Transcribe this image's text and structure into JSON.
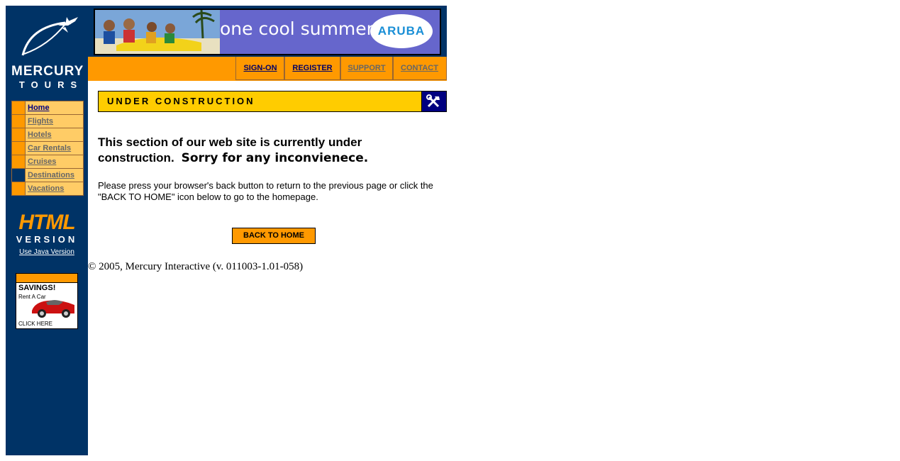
{
  "sidebar": {
    "logo": {
      "word1": "MERCURY",
      "word2": "TOURS"
    },
    "nav": [
      {
        "label": "Home",
        "active": true
      },
      {
        "label": "Flights",
        "active": false
      },
      {
        "label": "Hotels",
        "active": false
      },
      {
        "label": "Car Rentals",
        "active": false
      },
      {
        "label": "Cruises",
        "active": false
      },
      {
        "label": "Destinations",
        "active": false
      },
      {
        "label": "Vacations",
        "active": false
      }
    ],
    "html_version": {
      "big": "HTML",
      "small": "VERSION",
      "java_link": "Use Java Version"
    },
    "ad": {
      "title": "SAVINGS!",
      "subtitle": "Rent A Car",
      "cta": "CLICK HERE"
    }
  },
  "banner": {
    "text": "one cool summer",
    "brand": "ARUBA"
  },
  "topnav": {
    "signon": "SIGN-ON",
    "register": "REGISTER",
    "support": "SUPPORT",
    "contact": "CONTACT"
  },
  "main": {
    "section_title": "UNDER CONSTRUCTION",
    "heading": "This section of our web site is currently under construction.",
    "apology": "Sorry for any inconvienece.",
    "body": "Please press your browser's back button to return to the previous page or click the \"BACK TO HOME\" icon below to go to the homepage.",
    "back_button": "BACK TO HOME"
  },
  "footer": {
    "copyright": "© 2005, Mercury Interactive (v. 011003-1.01-058)"
  },
  "colors": {
    "navy": "#003366",
    "orange": "#ff9900",
    "yellow": "#ffcc00",
    "light_orange": "#ffcc66"
  }
}
